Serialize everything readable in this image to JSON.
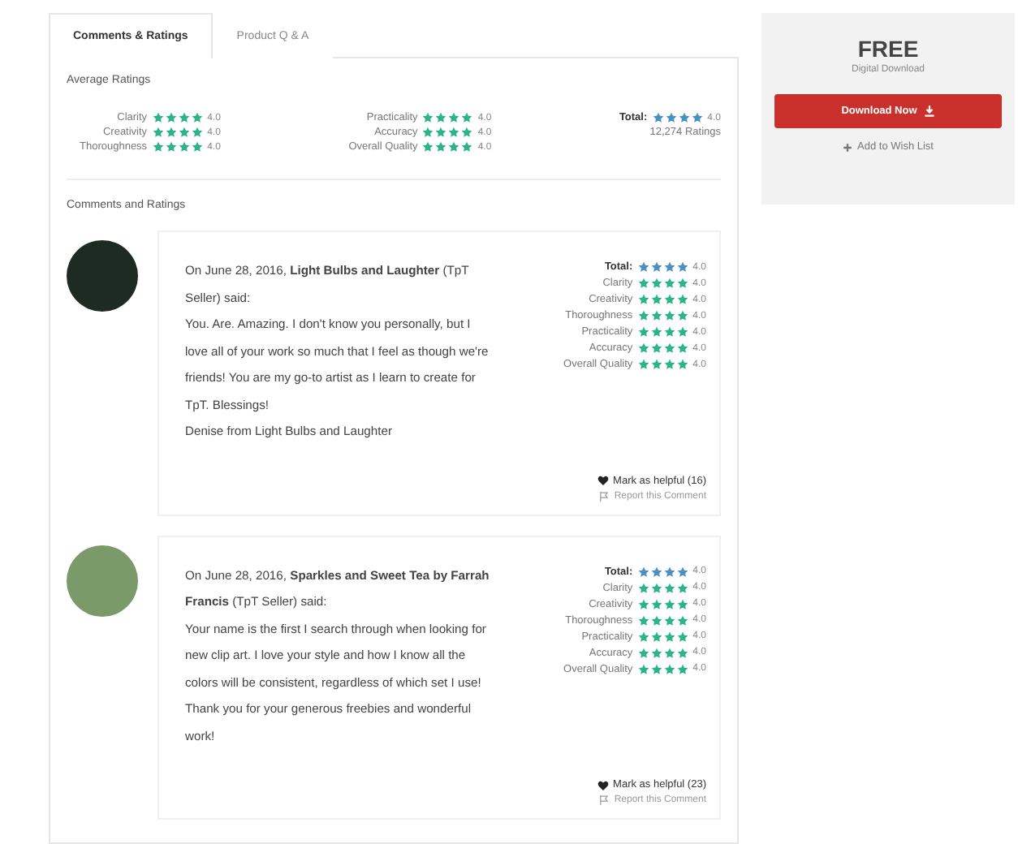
{
  "tabs": [
    {
      "label": "Comments & Ratings",
      "selected": true
    },
    {
      "label": "Product Q & A",
      "selected": false
    }
  ],
  "average": {
    "title": "Average Ratings",
    "columns": [
      [
        {
          "label": "Clarity",
          "stars": 4,
          "value": "4.0"
        },
        {
          "label": "Creativity",
          "stars": 4,
          "value": "4.0"
        },
        {
          "label": "Thoroughness",
          "stars": 4,
          "value": "4.0"
        }
      ],
      [
        {
          "label": "Practicality",
          "stars": 4,
          "value": "4.0"
        },
        {
          "label": "Accuracy",
          "stars": 4,
          "value": "4.0"
        },
        {
          "label": "Overall Quality",
          "stars": 4,
          "value": "4.0"
        }
      ]
    ],
    "total": {
      "label": "Total:",
      "stars": 4,
      "value": "4.0"
    },
    "count": "12,274 Ratings"
  },
  "comments_title": "Comments and Ratings",
  "reviews": [
    {
      "date": "On June 28, 2016,",
      "author": "Light Bulbs and Laughter",
      "suffix": "(TpT Seller) said:",
      "body": [
        "You. Are. Amazing. I don't know you personally, but I love all of your work so much that I feel as though we're friends! You are my go-to artist as I learn to create for TpT. Blessings!",
        "Denise from Light Bulbs and Laughter"
      ],
      "ratings": [
        {
          "label": "Total:",
          "stars": 4,
          "value": "4.0",
          "kind": "total"
        },
        {
          "label": "Clarity",
          "stars": 4,
          "value": "4.0",
          "kind": "item"
        },
        {
          "label": "Creativity",
          "stars": 4,
          "value": "4.0",
          "kind": "item"
        },
        {
          "label": "Thoroughness",
          "stars": 4,
          "value": "4.0",
          "kind": "item"
        },
        {
          "label": "Practicality",
          "stars": 4,
          "value": "4.0",
          "kind": "item"
        },
        {
          "label": "Accuracy",
          "stars": 4,
          "value": "4.0",
          "kind": "item"
        },
        {
          "label": "Overall Quality",
          "stars": 4,
          "value": "4.0",
          "kind": "item"
        }
      ],
      "helpful": "Mark as helpful (16)",
      "report": "Report this Comment"
    },
    {
      "date": "On June 28, 2016,",
      "author": "Sparkles and Sweet Tea by Farrah Francis",
      "suffix": "(TpT Seller) said:",
      "body": [
        "Your name is the first I search through when looking for new clip art. I love your style and how I know all the colors will be consistent, regardless of which set I use! Thank you for your generous freebies and wonderful work!"
      ],
      "ratings": [
        {
          "label": "Total:",
          "stars": 4,
          "value": "4.0",
          "kind": "total"
        },
        {
          "label": "Clarity",
          "stars": 4,
          "value": "4.0",
          "kind": "item"
        },
        {
          "label": "Creativity",
          "stars": 4,
          "value": "4.0",
          "kind": "item"
        },
        {
          "label": "Thoroughness",
          "stars": 4,
          "value": "4.0",
          "kind": "item"
        },
        {
          "label": "Practicality",
          "stars": 4,
          "value": "4.0",
          "kind": "item"
        },
        {
          "label": "Accuracy",
          "stars": 4,
          "value": "4.0",
          "kind": "item"
        },
        {
          "label": "Overall Quality",
          "stars": 4,
          "value": "4.0",
          "kind": "item"
        }
      ],
      "helpful": "Mark as helpful (23)",
      "report": "Report this Comment"
    }
  ],
  "sidebar": {
    "price": "FREE",
    "format": "Digital Download",
    "download": "Download Now",
    "wishlist": "Add to Wish List"
  }
}
